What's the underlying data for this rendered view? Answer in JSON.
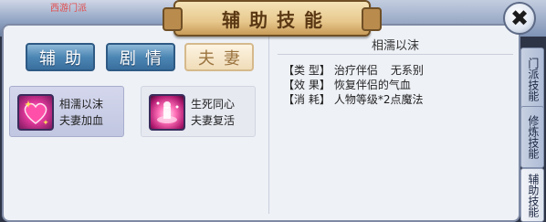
{
  "background": {
    "partial_text": "西游门派"
  },
  "window": {
    "title": "辅助技能"
  },
  "tabs": [
    {
      "label": "辅助",
      "state": "inactive"
    },
    {
      "label": "剧情",
      "state": "inactive"
    },
    {
      "label": "夫妻",
      "state": "active"
    }
  ],
  "skills": [
    {
      "name": "相濡以沫",
      "desc": "夫妻加血",
      "icon": "heart-icon",
      "selected": true
    },
    {
      "name": "生死同心",
      "desc": "夫妻复活",
      "icon": "revive-icon",
      "selected": false
    }
  ],
  "detail": {
    "title": "相濡以沫",
    "type_label": "【类 型】",
    "type_value": "治疗伴侣",
    "type_extra": "无系别",
    "effect_label": "【效 果】",
    "effect_value": "恢复伴侣的气血",
    "cost_label": "【消 耗】",
    "cost_value": "人物等级*2点魔法"
  },
  "side_tabs": [
    {
      "label": "门派技能",
      "state": "inactive"
    },
    {
      "label": "修炼技能",
      "state": "inactive"
    },
    {
      "label": "辅助技能",
      "state": "active"
    }
  ],
  "colors": {
    "tab_blue": "#4c86b4",
    "tab_active": "#f0dcb8",
    "title_plate": "#e7c88d",
    "panel_bg": "#eef1f6"
  }
}
